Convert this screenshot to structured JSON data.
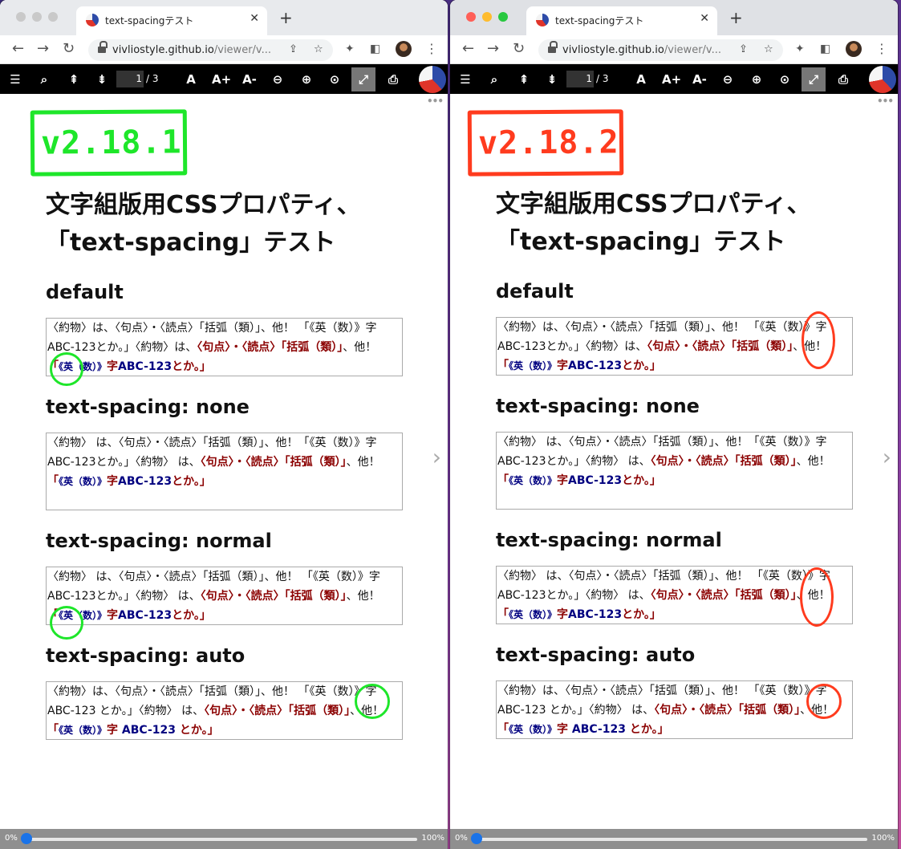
{
  "colors": {
    "left_badge": "#1ee62a",
    "right_badge": "#ff3b1e",
    "emphasis": "#8b0000",
    "alpha": "#000080",
    "toolbar_bg": "#000000"
  },
  "windows": [
    {
      "tab_title": "text-spacingテスト",
      "url_host": "vivliostyle.github.io",
      "url_path": "/viewer/v...",
      "page_current": "1",
      "page_total": "/ 3",
      "version_badge": "v2.18.1",
      "doc_title_line1": "文字組版用CSSプロパティ、",
      "doc_title_line2": "「text-spacing」テスト",
      "sections": [
        {
          "heading": "default",
          "text_a": "〈約物〉は、〈句点〉・〈読点〉「括弧（類）」、他！ 「《英（数）》字ABC-123とか。」〈約物〉は、",
          "text_em": "〈句点〉・〈読点〉「括弧（類）」",
          "text_b": "、他！ ",
          "text_em2": "「",
          "text_alpha": "《英（数）》",
          "text_em3": "字",
          "text_alpha2": "ABC-123",
          "text_em4": "とか。」"
        },
        {
          "heading": "text-spacing: none",
          "text_a": "〈約物〉 は、〈句点〉・〈読点〉「括弧（類）」、他！「《英（数）》字ABC-123とか。」〈約物〉 は、",
          "text_em": "〈句点〉・〈読点〉「括弧（類）」",
          "text_b": "、他！ ",
          "text_em2": "「",
          "text_alpha": "《英（数）》",
          "text_em3": "字",
          "text_alpha2": "ABC-123",
          "text_em4": "とか。」"
        },
        {
          "heading": "text-spacing: normal",
          "text_a": "〈約物〉 は、〈句点〉・〈読点〉「括弧（類）」、他！ 「《英（数）》字ABC-123とか。」〈約物〉 は、",
          "text_em": "〈句点〉・〈読点〉「括弧（類）」",
          "text_b": "、他！ ",
          "text_em2": "「",
          "text_alpha": "《英（数）》",
          "text_em3": "字",
          "text_alpha2": "ABC-123",
          "text_em4": "とか。」"
        },
        {
          "heading": "text-spacing: auto",
          "text_a": "〈約物〉は、〈句点〉・〈読点〉「括弧（類）」、他！ 「《英（数）》字 ABC-123 とか。」〈約物〉 は、",
          "text_em": "〈句点〉・〈読点〉「括弧（類）」",
          "text_b": "、他！ ",
          "text_em2": "「",
          "text_alpha": "《英（数）》",
          "text_em3": "字 ",
          "text_alpha2": "ABC-123",
          "text_em4": " とか。」"
        }
      ],
      "scrub_start": "0%",
      "scrub_end": "100%"
    },
    {
      "tab_title": "text-spacingテスト",
      "url_host": "vivliostyle.github.io",
      "url_path": "/viewer/v...",
      "page_current": "1",
      "page_total": "/ 3",
      "version_badge": "v2.18.2",
      "doc_title_line1": "文字組版用CSSプロパティ、",
      "doc_title_line2": "「text-spacing」テスト",
      "sections": [
        {
          "heading": "default",
          "text_a": "〈約物〉は、〈句点〉・〈読点〉「括弧（類）」、他！ 「《英（数）》字ABC-123とか。」〈約物〉は、",
          "text_em": "〈句点〉・〈読点〉「括弧（類）」",
          "text_b": "、他！ ",
          "text_em2": "「",
          "text_alpha": "《英（数）》",
          "text_em3": "字",
          "text_alpha2": "ABC-123",
          "text_em4": "とか。」"
        },
        {
          "heading": "text-spacing: none",
          "text_a": "〈約物〉 は、〈句点〉・〈読点〉「括弧（類）」、他！「《英（数）》字ABC-123とか。」〈約物〉 は、",
          "text_em": "〈句点〉・〈読点〉「括弧（類）」",
          "text_b": "、他！ ",
          "text_em2": "「",
          "text_alpha": "《英（数）》",
          "text_em3": "字",
          "text_alpha2": "ABC-123",
          "text_em4": "とか。」"
        },
        {
          "heading": "text-spacing: normal",
          "text_a": "〈約物〉 は、〈句点〉・〈読点〉「括弧（類）」、他！ 「《英（数）》字ABC-123とか。」〈約物〉 は、",
          "text_em": "〈句点〉・〈読点〉「括弧（類）」",
          "text_b": "、他！ ",
          "text_em2": "「",
          "text_alpha": "《英（数）》",
          "text_em3": "字",
          "text_alpha2": "ABC-123",
          "text_em4": "とか。」"
        },
        {
          "heading": "text-spacing: auto",
          "text_a": "〈約物〉は、〈句点〉・〈読点〉「括弧（類）」、他！ 「《英（数）》字 ABC-123 とか。」〈約物〉 は、",
          "text_em": "〈句点〉・〈読点〉「括弧（類）」",
          "text_b": "、他！ ",
          "text_em2": "「",
          "text_alpha": "《英（数）》",
          "text_em3": "字 ",
          "text_alpha2": "ABC-123",
          "text_em4": " とか。」"
        }
      ],
      "scrub_start": "0%",
      "scrub_end": "100%"
    }
  ],
  "icons": {
    "close": "✕",
    "newtab": "+",
    "back": "←",
    "forward": "→",
    "reload": "↻",
    "share": "⇪",
    "star": "☆",
    "extensions": "✦",
    "sidepanel": "◧",
    "kebab": "⋮",
    "toc": "☰",
    "search": "⌕",
    "first": "⇞",
    "next_page": "⇟",
    "font_reset": "A",
    "font_up": "A+",
    "font_down": "A-",
    "zoom_out": "⊖",
    "zoom_in": "⊕",
    "zoom_fit": "⊙",
    "fullscreen": "⤢",
    "print": "⎙",
    "more": "•••",
    "next": "›"
  }
}
